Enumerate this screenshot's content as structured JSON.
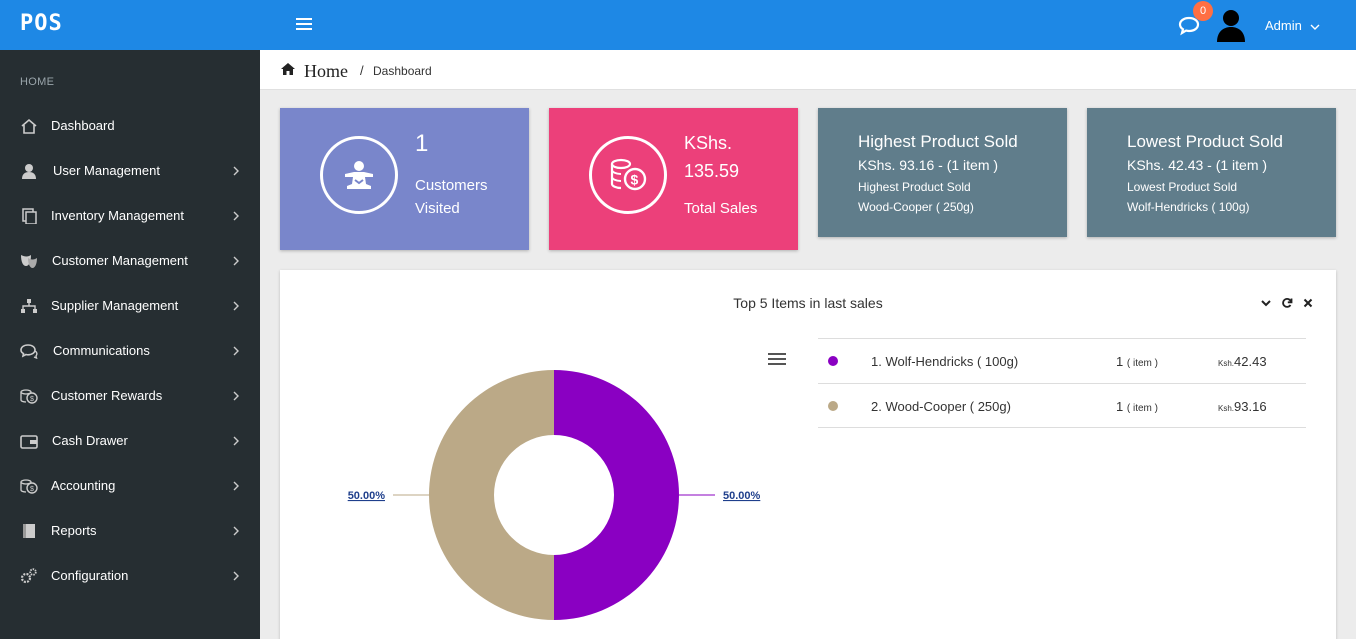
{
  "topbar": {
    "brand": "POS",
    "notification_count": "0",
    "user_name": "Admin"
  },
  "sidebar": {
    "header": "HOME",
    "items": [
      {
        "label": "Dashboard",
        "icon": "home-icon",
        "has_submenu": false
      },
      {
        "label": "User Management",
        "icon": "user-tie-icon",
        "has_submenu": true
      },
      {
        "label": "Inventory Management",
        "icon": "copy-icon",
        "has_submenu": true
      },
      {
        "label": "Customer Management",
        "icon": "masks-icon",
        "has_submenu": true
      },
      {
        "label": "Supplier Management",
        "icon": "sitemap-icon",
        "has_submenu": true
      },
      {
        "label": "Communications",
        "icon": "comments-icon",
        "has_submenu": true
      },
      {
        "label": "Customer Rewards",
        "icon": "coins-icon",
        "has_submenu": true
      },
      {
        "label": "Cash Drawer",
        "icon": "wallet-icon",
        "has_submenu": true
      },
      {
        "label": "Accounting",
        "icon": "coins-icon",
        "has_submenu": true
      },
      {
        "label": "Reports",
        "icon": "book-icon",
        "has_submenu": true
      },
      {
        "label": "Configuration",
        "icon": "cogs-icon",
        "has_submenu": true
      }
    ]
  },
  "breadcrumb": {
    "home": "Home",
    "separator": "/",
    "current": "Dashboard"
  },
  "cards": {
    "customers": {
      "value": "1",
      "line1": "Customers",
      "line2": "Visited",
      "color": "#7986cb"
    },
    "sales": {
      "currency": "KShs.",
      "value": "135.59",
      "label": "Total Sales",
      "color": "#ec407a"
    },
    "highest": {
      "title": "Highest Product Sold",
      "summary": "KShs. 93.16 - (1 item )",
      "caption": "Highest Product Sold",
      "product": "Wood-Cooper ( 250g)",
      "color": "#607d8b"
    },
    "lowest": {
      "title": "Lowest Product Sold",
      "summary": "KShs. 42.43 - (1 item )",
      "caption": "Lowest Product Sold",
      "product": "Wolf-Hendricks ( 100g)",
      "color": "#607d8b"
    }
  },
  "panel": {
    "title": "Top 5 Items in last sales",
    "legend": [
      {
        "name": "1. Wolf-Hendricks ( 100g)",
        "qty": "1",
        "unit": "( item )",
        "currency": "Ksh.",
        "price": "42.43",
        "color": "#8a00c2"
      },
      {
        "name": "2. Wood-Cooper ( 250g)",
        "qty": "1",
        "unit": "( item )",
        "currency": "Ksh.",
        "price": "93.16",
        "color": "#bba987"
      }
    ]
  },
  "chart_data": {
    "type": "pie",
    "categories": [
      "Wolf-Hendricks ( 100g)",
      "Wood-Cooper ( 250g)"
    ],
    "values": [
      50.0,
      50.0
    ],
    "labels": [
      "50.00%",
      "50.00%"
    ],
    "colors": [
      "#8a00c2",
      "#bba987"
    ],
    "donut": true
  }
}
